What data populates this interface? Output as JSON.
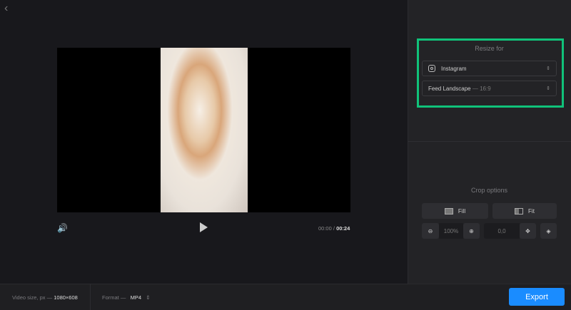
{
  "nav": {
    "back_icon": "chevron-left-icon",
    "back_glyph": "‹"
  },
  "player": {
    "current_time": "00:00",
    "separator": "/",
    "duration": "00:24",
    "volume_glyph": "🔊"
  },
  "resize": {
    "title": "Resize for",
    "platform": "Instagram",
    "format": "Feed Landscape",
    "ratio": "16:9",
    "dash": "—",
    "arrows": "⇕"
  },
  "crop": {
    "title": "Crop options",
    "fill": "Fill",
    "fit": "Fit",
    "zoom": "100%",
    "position": "0,0",
    "zoom_out": "⊖",
    "zoom_in": "⊕",
    "move": "✥",
    "fill_color": "◈"
  },
  "footer": {
    "video_size_label": "Video size, px —",
    "video_size": "1080×608",
    "format_label": "Format —",
    "format": "MP4",
    "format_arrows": "⇕",
    "export": "Export"
  },
  "colors": {
    "accent": "#1a8cff",
    "highlight": "#10c27a"
  }
}
